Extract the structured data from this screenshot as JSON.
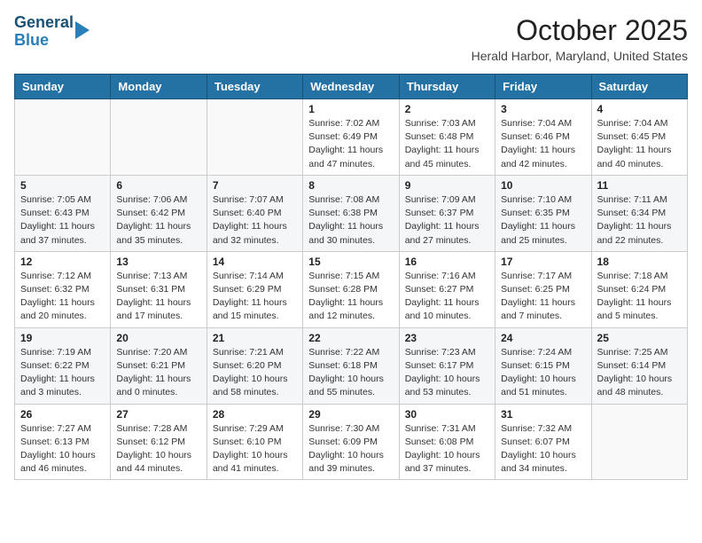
{
  "header": {
    "logo_line1": "General",
    "logo_line2": "Blue",
    "month_year": "October 2025",
    "location": "Herald Harbor, Maryland, United States"
  },
  "days_of_week": [
    "Sunday",
    "Monday",
    "Tuesday",
    "Wednesday",
    "Thursday",
    "Friday",
    "Saturday"
  ],
  "weeks": [
    [
      {
        "day": "",
        "info": ""
      },
      {
        "day": "",
        "info": ""
      },
      {
        "day": "",
        "info": ""
      },
      {
        "day": "1",
        "info": "Sunrise: 7:02 AM\nSunset: 6:49 PM\nDaylight: 11 hours\nand 47 minutes."
      },
      {
        "day": "2",
        "info": "Sunrise: 7:03 AM\nSunset: 6:48 PM\nDaylight: 11 hours\nand 45 minutes."
      },
      {
        "day": "3",
        "info": "Sunrise: 7:04 AM\nSunset: 6:46 PM\nDaylight: 11 hours\nand 42 minutes."
      },
      {
        "day": "4",
        "info": "Sunrise: 7:04 AM\nSunset: 6:45 PM\nDaylight: 11 hours\nand 40 minutes."
      }
    ],
    [
      {
        "day": "5",
        "info": "Sunrise: 7:05 AM\nSunset: 6:43 PM\nDaylight: 11 hours\nand 37 minutes."
      },
      {
        "day": "6",
        "info": "Sunrise: 7:06 AM\nSunset: 6:42 PM\nDaylight: 11 hours\nand 35 minutes."
      },
      {
        "day": "7",
        "info": "Sunrise: 7:07 AM\nSunset: 6:40 PM\nDaylight: 11 hours\nand 32 minutes."
      },
      {
        "day": "8",
        "info": "Sunrise: 7:08 AM\nSunset: 6:38 PM\nDaylight: 11 hours\nand 30 minutes."
      },
      {
        "day": "9",
        "info": "Sunrise: 7:09 AM\nSunset: 6:37 PM\nDaylight: 11 hours\nand 27 minutes."
      },
      {
        "day": "10",
        "info": "Sunrise: 7:10 AM\nSunset: 6:35 PM\nDaylight: 11 hours\nand 25 minutes."
      },
      {
        "day": "11",
        "info": "Sunrise: 7:11 AM\nSunset: 6:34 PM\nDaylight: 11 hours\nand 22 minutes."
      }
    ],
    [
      {
        "day": "12",
        "info": "Sunrise: 7:12 AM\nSunset: 6:32 PM\nDaylight: 11 hours\nand 20 minutes."
      },
      {
        "day": "13",
        "info": "Sunrise: 7:13 AM\nSunset: 6:31 PM\nDaylight: 11 hours\nand 17 minutes."
      },
      {
        "day": "14",
        "info": "Sunrise: 7:14 AM\nSunset: 6:29 PM\nDaylight: 11 hours\nand 15 minutes."
      },
      {
        "day": "15",
        "info": "Sunrise: 7:15 AM\nSunset: 6:28 PM\nDaylight: 11 hours\nand 12 minutes."
      },
      {
        "day": "16",
        "info": "Sunrise: 7:16 AM\nSunset: 6:27 PM\nDaylight: 11 hours\nand 10 minutes."
      },
      {
        "day": "17",
        "info": "Sunrise: 7:17 AM\nSunset: 6:25 PM\nDaylight: 11 hours\nand 7 minutes."
      },
      {
        "day": "18",
        "info": "Sunrise: 7:18 AM\nSunset: 6:24 PM\nDaylight: 11 hours\nand 5 minutes."
      }
    ],
    [
      {
        "day": "19",
        "info": "Sunrise: 7:19 AM\nSunset: 6:22 PM\nDaylight: 11 hours\nand 3 minutes."
      },
      {
        "day": "20",
        "info": "Sunrise: 7:20 AM\nSunset: 6:21 PM\nDaylight: 11 hours\nand 0 minutes."
      },
      {
        "day": "21",
        "info": "Sunrise: 7:21 AM\nSunset: 6:20 PM\nDaylight: 10 hours\nand 58 minutes."
      },
      {
        "day": "22",
        "info": "Sunrise: 7:22 AM\nSunset: 6:18 PM\nDaylight: 10 hours\nand 55 minutes."
      },
      {
        "day": "23",
        "info": "Sunrise: 7:23 AM\nSunset: 6:17 PM\nDaylight: 10 hours\nand 53 minutes."
      },
      {
        "day": "24",
        "info": "Sunrise: 7:24 AM\nSunset: 6:15 PM\nDaylight: 10 hours\nand 51 minutes."
      },
      {
        "day": "25",
        "info": "Sunrise: 7:25 AM\nSunset: 6:14 PM\nDaylight: 10 hours\nand 48 minutes."
      }
    ],
    [
      {
        "day": "26",
        "info": "Sunrise: 7:27 AM\nSunset: 6:13 PM\nDaylight: 10 hours\nand 46 minutes."
      },
      {
        "day": "27",
        "info": "Sunrise: 7:28 AM\nSunset: 6:12 PM\nDaylight: 10 hours\nand 44 minutes."
      },
      {
        "day": "28",
        "info": "Sunrise: 7:29 AM\nSunset: 6:10 PM\nDaylight: 10 hours\nand 41 minutes."
      },
      {
        "day": "29",
        "info": "Sunrise: 7:30 AM\nSunset: 6:09 PM\nDaylight: 10 hours\nand 39 minutes."
      },
      {
        "day": "30",
        "info": "Sunrise: 7:31 AM\nSunset: 6:08 PM\nDaylight: 10 hours\nand 37 minutes."
      },
      {
        "day": "31",
        "info": "Sunrise: 7:32 AM\nSunset: 6:07 PM\nDaylight: 10 hours\nand 34 minutes."
      },
      {
        "day": "",
        "info": ""
      }
    ]
  ]
}
